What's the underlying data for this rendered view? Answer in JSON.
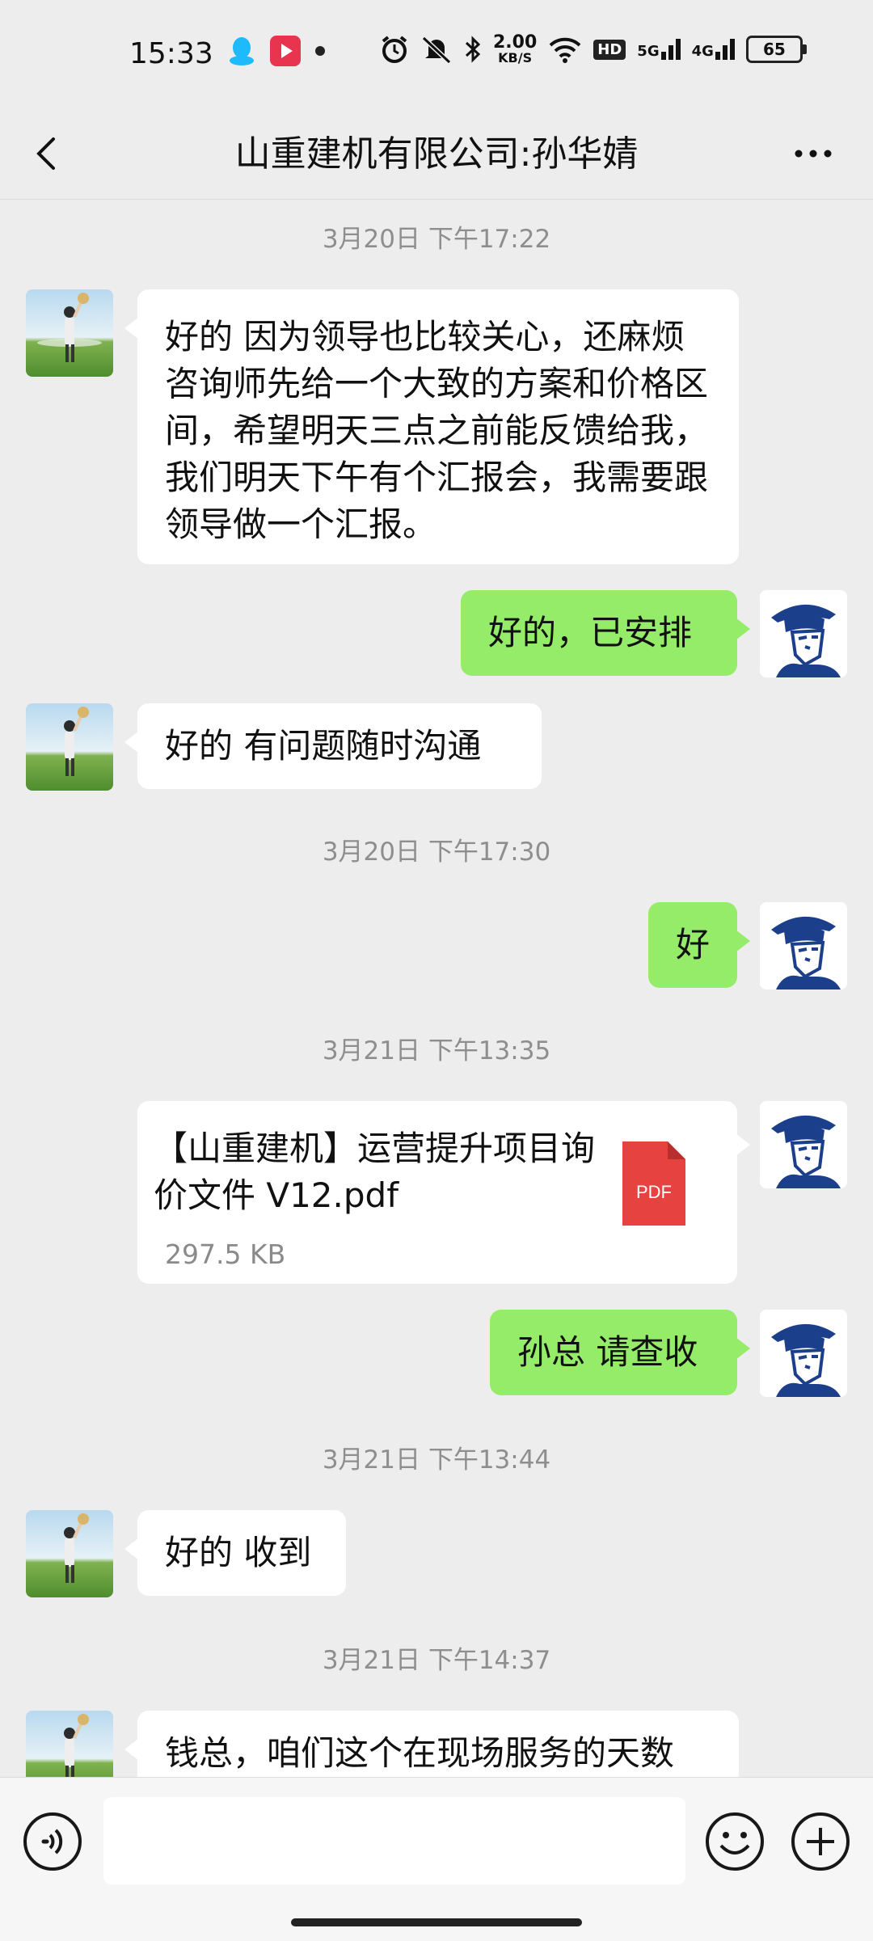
{
  "status_bar": {
    "time": "15:33",
    "net_speed_value": "2.00",
    "net_speed_unit": "KB/S",
    "hd_label": "HD",
    "signal_1": "5G",
    "signal_2": "4G",
    "battery": "65"
  },
  "header": {
    "title": "山重建机有限公司:孙华婧"
  },
  "messages": [
    {
      "type": "timestamp",
      "text": "3月20日 下午17:22"
    },
    {
      "type": "text",
      "side": "left",
      "text": "好的  因为领导也比较关心，还麻烦咨询师先给一个大致的方案和价格区间，希望明天三点之前能反馈给我，我们明天下午有个汇报会，我需要跟领导做一个汇报。"
    },
    {
      "type": "text",
      "side": "right",
      "text": "好的，已安排"
    },
    {
      "type": "text",
      "side": "left",
      "text": "好的  有问题随时沟通"
    },
    {
      "type": "timestamp",
      "text": "3月20日 下午17:30"
    },
    {
      "type": "text",
      "side": "right",
      "text": "好"
    },
    {
      "type": "timestamp",
      "text": "3月21日 下午13:35"
    },
    {
      "type": "file",
      "side": "right",
      "file_name": "【山重建机】运营提升项目询价文件 V12.pdf",
      "file_size": "297.5 KB",
      "file_badge": "PDF"
    },
    {
      "type": "text",
      "side": "right",
      "text": "孙总 请查收"
    },
    {
      "type": "timestamp",
      "text": "3月21日 下午13:44"
    },
    {
      "type": "text",
      "side": "left",
      "text": "好的 收到"
    },
    {
      "type": "timestamp",
      "text": "3月21日 下午14:37"
    },
    {
      "type": "text",
      "side": "left",
      "text": "钱总，咱们这个在现场服务的天数"
    }
  ],
  "colors": {
    "background": "#ededed",
    "my_bubble": "#95ec69",
    "their_bubble": "#ffffff",
    "pdf_icon": "#e64340"
  },
  "icons": {
    "back": "chevron-left-icon",
    "more": "more-dots-icon",
    "voice": "voice-icon",
    "emoji": "emoji-icon",
    "plus": "plus-icon"
  }
}
